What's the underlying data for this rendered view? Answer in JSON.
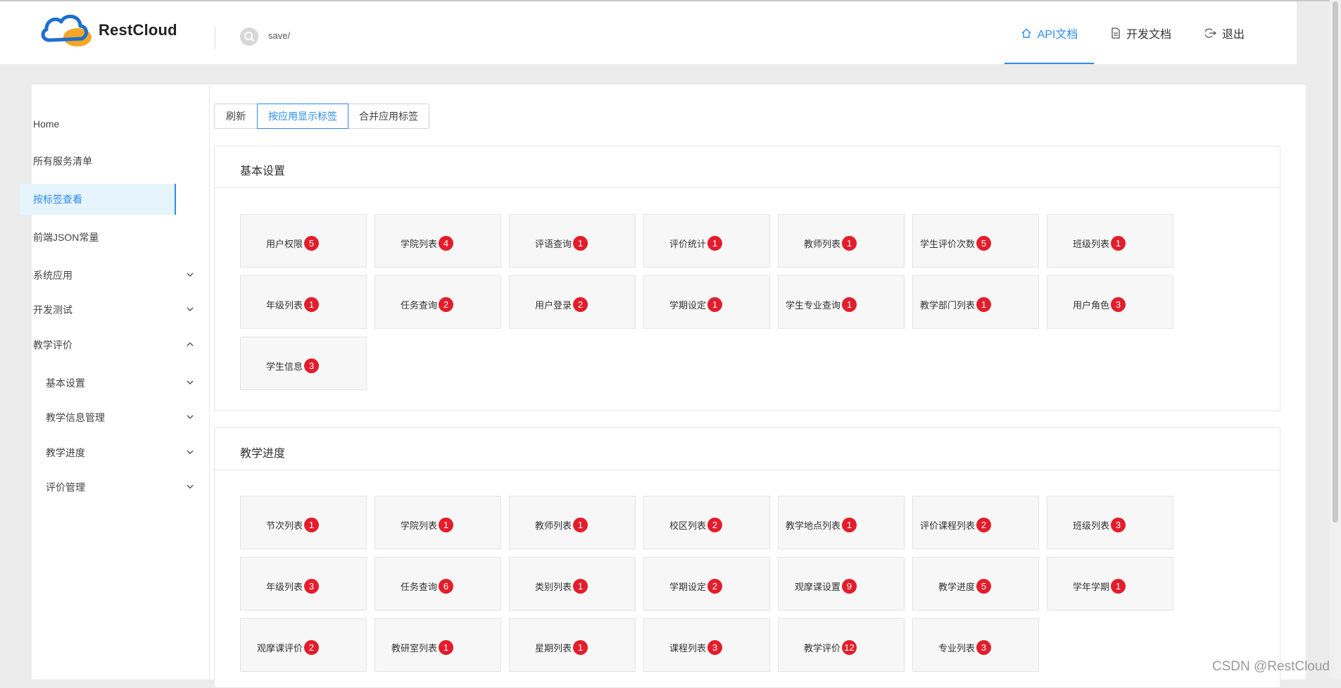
{
  "app": {
    "name": "RestCloud"
  },
  "search": {
    "text": "save/"
  },
  "nav": [
    {
      "label": "API文档",
      "active": true,
      "icon": "home-icon"
    },
    {
      "label": "开发文档",
      "active": false,
      "icon": "document-icon"
    },
    {
      "label": "退出",
      "active": false,
      "icon": "logout-icon"
    }
  ],
  "sidebar": {
    "items": [
      {
        "label": "Home"
      },
      {
        "label": "所有服务清单"
      },
      {
        "label": "按标签查看",
        "active": true
      },
      {
        "label": "前端JSON常量"
      },
      {
        "label": "系统应用",
        "chevron": "down"
      },
      {
        "label": "开发测试",
        "chevron": "down"
      },
      {
        "label": "教学评价",
        "chevron": "up"
      },
      {
        "label": "基本设置",
        "chevron": "down",
        "sub": true
      },
      {
        "label": "教学信息管理",
        "chevron": "down",
        "sub": true
      },
      {
        "label": "教学进度",
        "chevron": "down",
        "sub": true
      },
      {
        "label": "评价管理",
        "chevron": "down",
        "sub": true
      }
    ]
  },
  "toolbar": {
    "buttons": [
      {
        "label": "刷新"
      },
      {
        "label": "按应用显示标签",
        "active": true
      },
      {
        "label": "合并应用标签"
      }
    ]
  },
  "sections": [
    {
      "title": "基本设置",
      "tags": [
        {
          "label": "用户权限",
          "count": "5"
        },
        {
          "label": "学院列表",
          "count": "4"
        },
        {
          "label": "评语查询",
          "count": "1"
        },
        {
          "label": "评价统计",
          "count": "1"
        },
        {
          "label": "教师列表",
          "count": "1"
        },
        {
          "label": "学生评价次数",
          "count": "5"
        },
        {
          "label": "班级列表",
          "count": "1"
        },
        {
          "label": "年级列表",
          "count": "1"
        },
        {
          "label": "任务查询",
          "count": "2"
        },
        {
          "label": "用户登录",
          "count": "2"
        },
        {
          "label": "学期设定",
          "count": "1"
        },
        {
          "label": "学生专业查询",
          "count": "1"
        },
        {
          "label": "教学部门列表",
          "count": "1"
        },
        {
          "label": "用户角色",
          "count": "3"
        },
        {
          "label": "学生信息",
          "count": "3"
        }
      ]
    },
    {
      "title": "教学进度",
      "tags": [
        {
          "label": "节次列表",
          "count": "1"
        },
        {
          "label": "学院列表",
          "count": "1"
        },
        {
          "label": "教师列表",
          "count": "1"
        },
        {
          "label": "校区列表",
          "count": "2"
        },
        {
          "label": "教学地点列表",
          "count": "1"
        },
        {
          "label": "评价课程列表",
          "count": "2"
        },
        {
          "label": "班级列表",
          "count": "3"
        },
        {
          "label": "年级列表",
          "count": "3"
        },
        {
          "label": "任务查询",
          "count": "6"
        },
        {
          "label": "类别列表",
          "count": "1"
        },
        {
          "label": "学期设定",
          "count": "2"
        },
        {
          "label": "观摩课设置",
          "count": "9"
        },
        {
          "label": "教学进度",
          "count": "5"
        },
        {
          "label": "学年学期",
          "count": "1"
        },
        {
          "label": "观摩课评价",
          "count": "2"
        },
        {
          "label": "教研室列表",
          "count": "1"
        },
        {
          "label": "星期列表",
          "count": "1"
        },
        {
          "label": "课程列表",
          "count": "3"
        },
        {
          "label": "教学评价",
          "count": "12"
        },
        {
          "label": "专业列表",
          "count": "3"
        }
      ]
    }
  ],
  "colors": {
    "accent": "#2d8cf0",
    "badge": "#e21d2c",
    "logo_blue": "#1d6fd1",
    "logo_orange": "#f5a623"
  },
  "watermark": "CSDN @RestCloud"
}
